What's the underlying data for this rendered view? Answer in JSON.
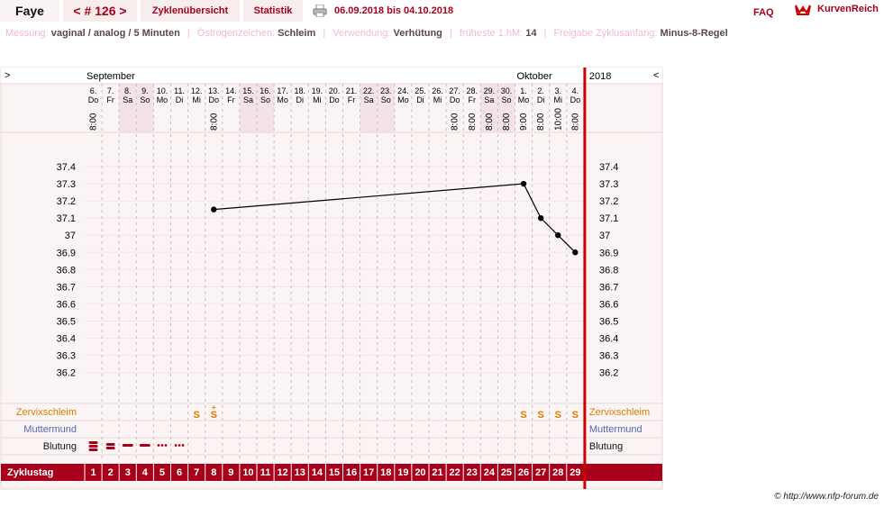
{
  "header": {
    "name": "Faye",
    "cycle_label": "< # 126 >",
    "tabs": [
      "Zyklenübersicht",
      "Statistik"
    ],
    "date_range": "06.09.2018 bis 04.10.2018",
    "faq": "FAQ",
    "logo_text": "KurvenReich"
  },
  "info": [
    {
      "label": "Messung:",
      "value": "vaginal / analog / 5 Minuten"
    },
    {
      "label": "Östrogenzeichen:",
      "value": "Schleim"
    },
    {
      "label": "Verwendung:",
      "value": "Verhütung"
    },
    {
      "label": "früheste 1.hM:",
      "value": "14"
    },
    {
      "label": "Freigabe Zyklusanfang:",
      "value": "Minus-8-Regel"
    }
  ],
  "nav": {
    "prev": ">",
    "next": "<"
  },
  "months": [
    {
      "label": "September",
      "start_index": 0
    },
    {
      "label": "Oktober",
      "start_index": 25
    }
  ],
  "year": "2018",
  "days": [
    {
      "d": "6.",
      "w": "Do",
      "time": "8:00",
      "weekend": false
    },
    {
      "d": "7.",
      "w": "Fr",
      "time": "",
      "weekend": false
    },
    {
      "d": "8.",
      "w": "Sa",
      "time": "",
      "weekend": true
    },
    {
      "d": "9.",
      "w": "So",
      "time": "",
      "weekend": true
    },
    {
      "d": "10.",
      "w": "Mo",
      "time": "",
      "weekend": false
    },
    {
      "d": "11.",
      "w": "Di",
      "time": "",
      "weekend": false
    },
    {
      "d": "12.",
      "w": "Mi",
      "time": "",
      "weekend": false
    },
    {
      "d": "13.",
      "w": "Do",
      "time": "8:00",
      "weekend": false
    },
    {
      "d": "14.",
      "w": "Fr",
      "time": "",
      "weekend": false
    },
    {
      "d": "15.",
      "w": "Sa",
      "time": "",
      "weekend": true
    },
    {
      "d": "16.",
      "w": "So",
      "time": "",
      "weekend": true
    },
    {
      "d": "17.",
      "w": "Mo",
      "time": "",
      "weekend": false
    },
    {
      "d": "18.",
      "w": "Di",
      "time": "",
      "weekend": false
    },
    {
      "d": "19.",
      "w": "Mi",
      "time": "",
      "weekend": false
    },
    {
      "d": "20.",
      "w": "Do",
      "time": "",
      "weekend": false
    },
    {
      "d": "21.",
      "w": "Fr",
      "time": "",
      "weekend": false
    },
    {
      "d": "22.",
      "w": "Sa",
      "time": "",
      "weekend": true
    },
    {
      "d": "23.",
      "w": "So",
      "time": "",
      "weekend": true
    },
    {
      "d": "24.",
      "w": "Mo",
      "time": "",
      "weekend": false
    },
    {
      "d": "25.",
      "w": "Di",
      "time": "",
      "weekend": false
    },
    {
      "d": "26.",
      "w": "Mi",
      "time": "",
      "weekend": false
    },
    {
      "d": "27.",
      "w": "Do",
      "time": "8:00",
      "weekend": false
    },
    {
      "d": "28.",
      "w": "Fr",
      "time": "8:00",
      "weekend": false
    },
    {
      "d": "29.",
      "w": "Sa",
      "time": "8:00",
      "weekend": true
    },
    {
      "d": "30.",
      "w": "So",
      "time": "8:00",
      "weekend": true
    },
    {
      "d": "1.",
      "w": "Mo",
      "time": "9:00",
      "weekend": false
    },
    {
      "d": "2.",
      "w": "Di",
      "time": "8:00",
      "weekend": false
    },
    {
      "d": "3.",
      "w": "Mi",
      "time": "10:00",
      "weekend": false
    },
    {
      "d": "4.",
      "w": "Do",
      "time": "8:00",
      "weekend": false
    }
  ],
  "temp_axis": [
    "37.4",
    "37.3",
    "37.2",
    "37.1",
    "37",
    "36.9",
    "36.8",
    "36.7",
    "36.6",
    "36.5",
    "36.4",
    "36.3",
    "36.2"
  ],
  "row_labels": {
    "mucus": "Zervixschleim",
    "cervix": "Muttermund",
    "bleeding": "Blutung",
    "cycle_day": "Zyklustag"
  },
  "mucus_marks": [
    {
      "cycle_day": 7,
      "text": "S"
    },
    {
      "cycle_day": 8,
      "text": "S",
      "sup": "+"
    },
    {
      "cycle_day": 26,
      "text": "S"
    },
    {
      "cycle_day": 27,
      "text": "S"
    },
    {
      "cycle_day": 28,
      "text": "S"
    },
    {
      "cycle_day": 29,
      "text": "S"
    }
  ],
  "bleeding": [
    {
      "cycle_day": 1,
      "strength": "heavy"
    },
    {
      "cycle_day": 2,
      "strength": "medium"
    },
    {
      "cycle_day": 3,
      "strength": "normal"
    },
    {
      "cycle_day": 4,
      "strength": "normal"
    },
    {
      "cycle_day": 5,
      "strength": "light"
    },
    {
      "cycle_day": 6,
      "strength": "light"
    }
  ],
  "cycle_days": [
    "1",
    "2",
    "3",
    "4",
    "5",
    "6",
    "7",
    "8",
    "9",
    "10",
    "11",
    "12",
    "13",
    "14",
    "15",
    "16",
    "17",
    "18",
    "19",
    "20",
    "21",
    "22",
    "23",
    "24",
    "25",
    "26",
    "27",
    "28",
    "29"
  ],
  "chart_data": {
    "type": "line",
    "title": "",
    "xlabel": "Zyklustag",
    "ylabel": "",
    "ylim": [
      36.2,
      37.4
    ],
    "series": [
      {
        "points": [
          {
            "cycle_day": 8,
            "temp": 37.15
          },
          {
            "cycle_day": 26,
            "temp": 37.3
          },
          {
            "cycle_day": 27,
            "temp": 37.1
          },
          {
            "cycle_day": 28,
            "temp": 37.0
          },
          {
            "cycle_day": 29,
            "temp": 36.9
          }
        ]
      }
    ],
    "colors": {
      "accent": "#a8001a",
      "mucus": "#e07b00",
      "cervix": "#5566bb",
      "weekend": "#f3e3e6",
      "grid": "#f7e4e7",
      "background": "#fbf4f4"
    }
  },
  "copyright": "© http://www.nfp-forum.de"
}
